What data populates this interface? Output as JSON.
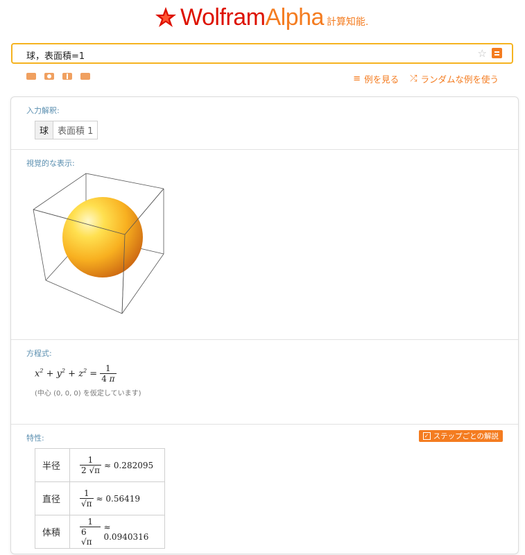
{
  "header": {
    "logo_wolfram": "Wolfram",
    "logo_alpha": "Alpha",
    "tagline": "計算知能."
  },
  "search": {
    "query": "球，表面積=1"
  },
  "links": {
    "examples": "例を見る",
    "random": "ランダムな例を使う"
  },
  "pods": {
    "interpretation": {
      "title": "入力解釈:",
      "part_a": "球",
      "part_b": "表面積 1"
    },
    "visual": {
      "title": "視覚的な表示:"
    },
    "equation": {
      "title": "方程式:",
      "note": "(中心 (0, 0, 0) を仮定しています)"
    },
    "properties": {
      "title": "特性:",
      "step_button": "ステップごとの解説",
      "rows": [
        {
          "label": "半径",
          "num": "1",
          "den": "2 √π",
          "approx": "≈ 0.282095"
        },
        {
          "label": "直径",
          "num": "1",
          "den": "√π",
          "approx": "≈ 0.56419"
        },
        {
          "label": "体積",
          "num": "1",
          "den": "6 √π",
          "approx": "≈ 0.0940316"
        }
      ]
    }
  },
  "colors": {
    "brand_red": "#dd1100",
    "brand_orange": "#f47c20",
    "pod_title": "#5b8fb0"
  }
}
